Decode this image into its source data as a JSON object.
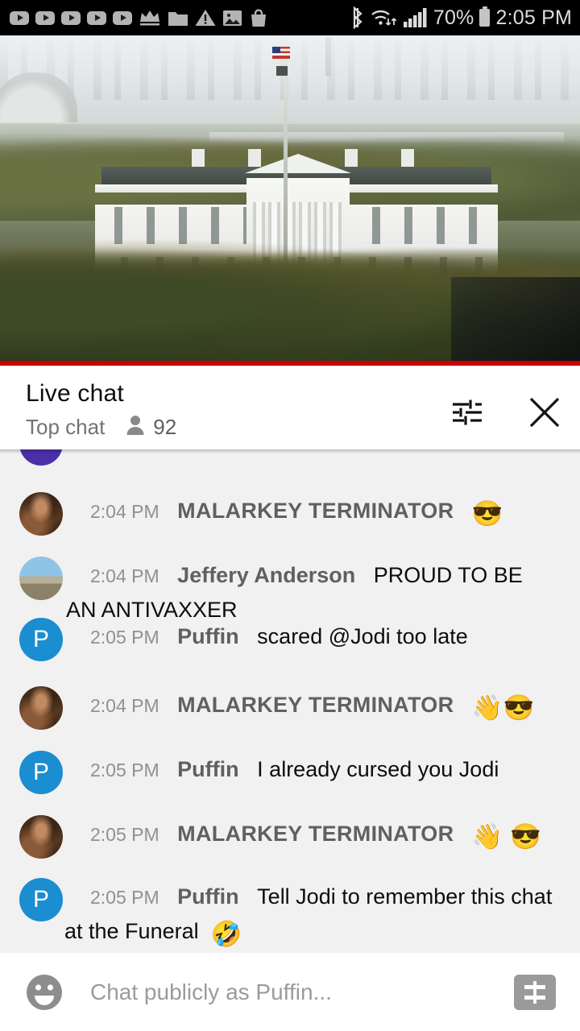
{
  "status_bar": {
    "left_icons": [
      "youtube-play-badge",
      "youtube-play-badge",
      "youtube-play-badge",
      "youtube-play-badge",
      "youtube-play-badge",
      "crown-icon",
      "folder-icon",
      "warning-triangle-icon",
      "image-icon",
      "shopping-bag-icon"
    ],
    "right_icons": [
      "bluetooth-icon",
      "wifi-data-icon",
      "cell-signal-icon",
      "battery-icon"
    ],
    "battery_percent": "70%",
    "clock": "2:05 PM",
    "background": "#000000",
    "foreground": "#dcdcdc"
  },
  "player": {
    "name": "live-video-player",
    "progress_color": "#cc0000",
    "progress_percent": 100
  },
  "chat_header": {
    "title": "Live chat",
    "mode": "Top chat",
    "viewer_icon": "person-icon",
    "viewer_count": "92",
    "settings_icon": "sliders-tune-icon",
    "close_icon": "close-x-icon"
  },
  "messages": [
    {
      "id": "msg-0",
      "timestamp": "",
      "author": "",
      "text": "",
      "emoji": "",
      "avatar": "purple-initial-avatar",
      "clipped": true
    },
    {
      "id": "msg-1",
      "timestamp": "2:04 PM",
      "author": "MALARKEY TERMINATOR",
      "text": "",
      "emoji": "😎",
      "avatar": "photo-avatar-malarkey"
    },
    {
      "id": "msg-2",
      "timestamp": "2:04 PM",
      "author": "Jeffery Anderson",
      "text": "PROUD TO BE AN ANTIVAXXER",
      "emoji": "",
      "avatar": "photo-avatar-jeffery"
    },
    {
      "id": "msg-3",
      "timestamp": "2:05 PM",
      "author": "Puffin",
      "text": "scared @Jodi too late",
      "emoji": "",
      "avatar": "letter-avatar-puffin"
    },
    {
      "id": "msg-4",
      "timestamp": "2:04 PM",
      "author": "MALARKEY TERMINATOR",
      "text": "",
      "emoji": "👋😎",
      "avatar": "photo-avatar-malarkey"
    },
    {
      "id": "msg-5",
      "timestamp": "2:05 PM",
      "author": "Puffin",
      "text": "I already cursed you Jodi",
      "emoji": "",
      "avatar": "letter-avatar-puffin"
    },
    {
      "id": "msg-6",
      "timestamp": "2:05 PM",
      "author": "MALARKEY TERMINATOR",
      "text": "",
      "emoji": "👋 😎",
      "avatar": "photo-avatar-malarkey"
    },
    {
      "id": "msg-7",
      "timestamp": "2:05 PM",
      "author": "Puffin",
      "text": "Tell Jodi to remember this chat at the Funeral",
      "emoji": "🤣",
      "avatar": "letter-avatar-puffin"
    }
  ],
  "message_rows": {
    "r1": {
      "ts": "2:04 PM",
      "author": "MALARKEY TERMINATOR",
      "emoji": "😎"
    },
    "r2": {
      "ts": "2:04 PM",
      "author": "Jeffery Anderson",
      "line1": "PROUD TO BE",
      "line2": "AN ANTIVAXXER"
    },
    "r3": {
      "ts": "2:05 PM",
      "author": "Puffin",
      "text": "scared @Jodi too late"
    },
    "r4": {
      "ts": "2:04 PM",
      "author": "MALARKEY TERMINATOR",
      "emoji": "👋😎"
    },
    "r5": {
      "ts": "2:05 PM",
      "author": "Puffin",
      "text": "I already cursed you Jodi"
    },
    "r6": {
      "ts": "2:05 PM",
      "author": "MALARKEY TERMINATOR",
      "emoji": "👋 😎"
    },
    "r7": {
      "ts": "2:05 PM",
      "author": "Puffin",
      "line1": "Tell Jodi to remember this chat",
      "line2": "at the Funeral",
      "emoji": "🤣"
    }
  },
  "input_bar": {
    "emoji_icon": "smiley-face-icon",
    "placeholder": "Chat publicly as Puffin...",
    "value": "",
    "superchat_icon": "money-dollar-icon"
  },
  "avatar_initials": {
    "puffin": "P"
  },
  "colors": {
    "chat_bg": "#f1f1f1",
    "header_bg": "#ffffff",
    "accent_red": "#cc0000",
    "puffin_blue": "#1b8dd1",
    "author_gray": "#606060",
    "timestamp_gray": "#909090",
    "placeholder_gray": "#9b9b9b"
  }
}
